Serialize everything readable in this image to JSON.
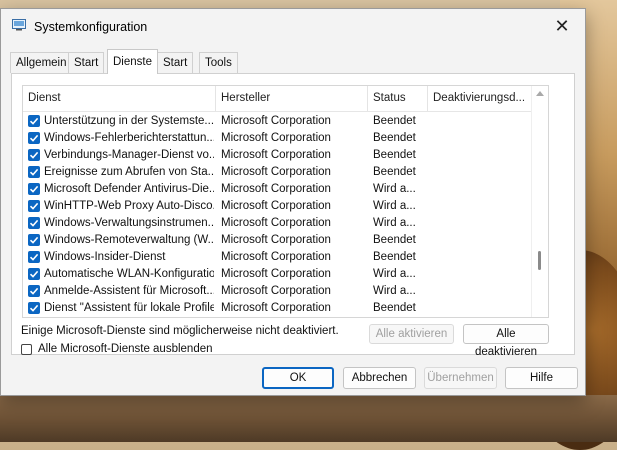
{
  "window": {
    "title": "Systemkonfiguration",
    "close_glyph": "✕"
  },
  "tabs": [
    {
      "label": "Allgemein"
    },
    {
      "label": "Start"
    },
    {
      "label": "Dienste"
    },
    {
      "label": "Start"
    },
    {
      "label": "Tools"
    }
  ],
  "active_tab": "Dienste",
  "columns": [
    "Dienst",
    "Hersteller",
    "Status",
    "Deaktivierungsd..."
  ],
  "services": [
    {
      "checked": true,
      "name": "Unterstützung in der Systemste...",
      "vendor": "Microsoft Corporation",
      "status": "Beendet",
      "deactivated": ""
    },
    {
      "checked": true,
      "name": "Windows-Fehlerberichterstattun...",
      "vendor": "Microsoft Corporation",
      "status": "Beendet",
      "deactivated": ""
    },
    {
      "checked": true,
      "name": "Verbindungs-Manager-Dienst vo...",
      "vendor": "Microsoft Corporation",
      "status": "Beendet",
      "deactivated": ""
    },
    {
      "checked": true,
      "name": "Ereignisse zum Abrufen von Sta...",
      "vendor": "Microsoft Corporation",
      "status": "Beendet",
      "deactivated": ""
    },
    {
      "checked": true,
      "name": "Microsoft Defender Antivirus-Die...",
      "vendor": "Microsoft Corporation",
      "status": "Wird a...",
      "deactivated": ""
    },
    {
      "checked": true,
      "name": "WinHTTP-Web Proxy Auto-Disco...",
      "vendor": "Microsoft Corporation",
      "status": "Wird a...",
      "deactivated": ""
    },
    {
      "checked": true,
      "name": "Windows-Verwaltungsinstrumen...",
      "vendor": "Microsoft Corporation",
      "status": "Wird a...",
      "deactivated": ""
    },
    {
      "checked": true,
      "name": "Windows-Remoteverwaltung (W...",
      "vendor": "Microsoft Corporation",
      "status": "Beendet",
      "deactivated": ""
    },
    {
      "checked": true,
      "name": "Windows-Insider-Dienst",
      "vendor": "Microsoft Corporation",
      "status": "Beendet",
      "deactivated": ""
    },
    {
      "checked": true,
      "name": "Automatische WLAN-Konfiguration",
      "vendor": "Microsoft Corporation",
      "status": "Wird a...",
      "deactivated": ""
    },
    {
      "checked": true,
      "name": "Anmelde-Assistent für Microsoft...",
      "vendor": "Microsoft Corporation",
      "status": "Wird a...",
      "deactivated": ""
    },
    {
      "checked": true,
      "name": "Dienst \"Assistent für lokale Profile\"",
      "vendor": "Microsoft Corporation",
      "status": "Beendet",
      "deactivated": ""
    }
  ],
  "note": "Einige Microsoft-Dienste sind möglicherweise nicht deaktiviert.",
  "enable_all_label": "Alle aktivieren",
  "disable_all_label": "Alle deaktivieren",
  "hide_ms_label": "Alle Microsoft-Dienste ausblenden",
  "hide_ms_checked": false,
  "footer": {
    "ok": "OK",
    "cancel": "Abbrechen",
    "apply": "Übernehmen",
    "help": "Hilfe"
  },
  "colors": {
    "accent": "#0b66c2"
  }
}
